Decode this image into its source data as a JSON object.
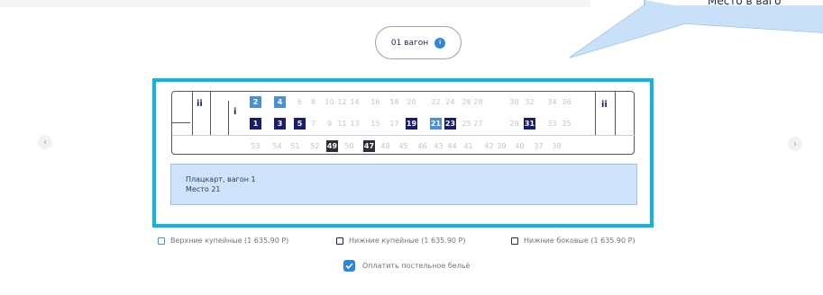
{
  "callout": {
    "text": "Место в ваго"
  },
  "car_selector": {
    "label": "01 вагон",
    "badge": "i"
  },
  "nav": {
    "prev": "‹",
    "next": "›"
  },
  "wc_labels": {
    "left": "🚻",
    "right": "🚻"
  },
  "upper_row": [
    {
      "n": "2",
      "state": "taken",
      "color": "#4a90d9"
    },
    {
      "n": "4",
      "state": "taken",
      "color": "#4a90d9"
    },
    {
      "n": "6",
      "state": "free"
    },
    {
      "n": "8",
      "state": "free"
    },
    {
      "n": "10",
      "state": "free"
    },
    {
      "n": "12",
      "state": "free"
    },
    {
      "n": "14",
      "state": "free"
    },
    {
      "n": "16",
      "state": "free"
    },
    {
      "n": "18",
      "state": "free"
    },
    {
      "n": "20",
      "state": "free"
    },
    {
      "n": "22",
      "state": "free"
    },
    {
      "n": "24",
      "state": "free"
    },
    {
      "n": "26",
      "state": "free"
    },
    {
      "n": "28",
      "state": "free"
    },
    {
      "n": "30",
      "state": "free"
    },
    {
      "n": "32",
      "state": "free"
    },
    {
      "n": "34",
      "state": "free"
    },
    {
      "n": "36",
      "state": "free"
    }
  ],
  "lower_row": [
    {
      "n": "1",
      "state": "taken",
      "color": "#1a1d6e"
    },
    {
      "n": "3",
      "state": "taken",
      "color": "#1a1d6e"
    },
    {
      "n": "5",
      "state": "taken",
      "color": "#1a1d6e"
    },
    {
      "n": "7",
      "state": "free"
    },
    {
      "n": "9",
      "state": "free"
    },
    {
      "n": "11",
      "state": "free"
    },
    {
      "n": "13",
      "state": "free"
    },
    {
      "n": "15",
      "state": "free"
    },
    {
      "n": "17",
      "state": "free"
    },
    {
      "n": "19",
      "state": "taken",
      "color": "#1a1d6e"
    },
    {
      "n": "21",
      "state": "taken",
      "color": "#4a90d9"
    },
    {
      "n": "23",
      "state": "taken",
      "color": "#1a1d6e"
    },
    {
      "n": "25",
      "state": "free"
    },
    {
      "n": "27",
      "state": "free"
    },
    {
      "n": "29",
      "state": "free"
    },
    {
      "n": "31",
      "state": "taken",
      "color": "#1a1d6e"
    },
    {
      "n": "33",
      "state": "free"
    },
    {
      "n": "35",
      "state": "free"
    }
  ],
  "side_row": [
    {
      "n": "53",
      "state": "free"
    },
    {
      "n": "54",
      "state": "free"
    },
    {
      "n": "51",
      "state": "free"
    },
    {
      "n": "52",
      "state": "free"
    },
    {
      "n": "49",
      "state": "taken",
      "color": "#2b2f36"
    },
    {
      "n": "50",
      "state": "free"
    },
    {
      "n": "47",
      "state": "taken",
      "color": "#2b2f36"
    },
    {
      "n": "48",
      "state": "free"
    },
    {
      "n": "45",
      "state": "free"
    },
    {
      "n": "46",
      "state": "free"
    },
    {
      "n": "43",
      "state": "free"
    },
    {
      "n": "44",
      "state": "free"
    },
    {
      "n": "41",
      "state": "free"
    },
    {
      "n": "42",
      "state": "free"
    },
    {
      "n": "39",
      "state": "free"
    },
    {
      "n": "40",
      "state": "free"
    },
    {
      "n": "37",
      "state": "free"
    },
    {
      "n": "38",
      "state": "free"
    }
  ],
  "info": {
    "line1": "Плацкарт, вагон 1",
    "line2": "Место 21"
  },
  "legend": [
    {
      "label": "Верхние купейные (1 635.90 Р)",
      "color": "#4a90d9"
    },
    {
      "label": "Нижние купейные (1 635.90 Р)",
      "color": "#1a1d6e"
    },
    {
      "label": "Нижние боковые (1 635.90 Р)",
      "color": "#2b2f36"
    }
  ],
  "bedding": {
    "label": "Оплатить постельное бельё",
    "checked": true
  }
}
